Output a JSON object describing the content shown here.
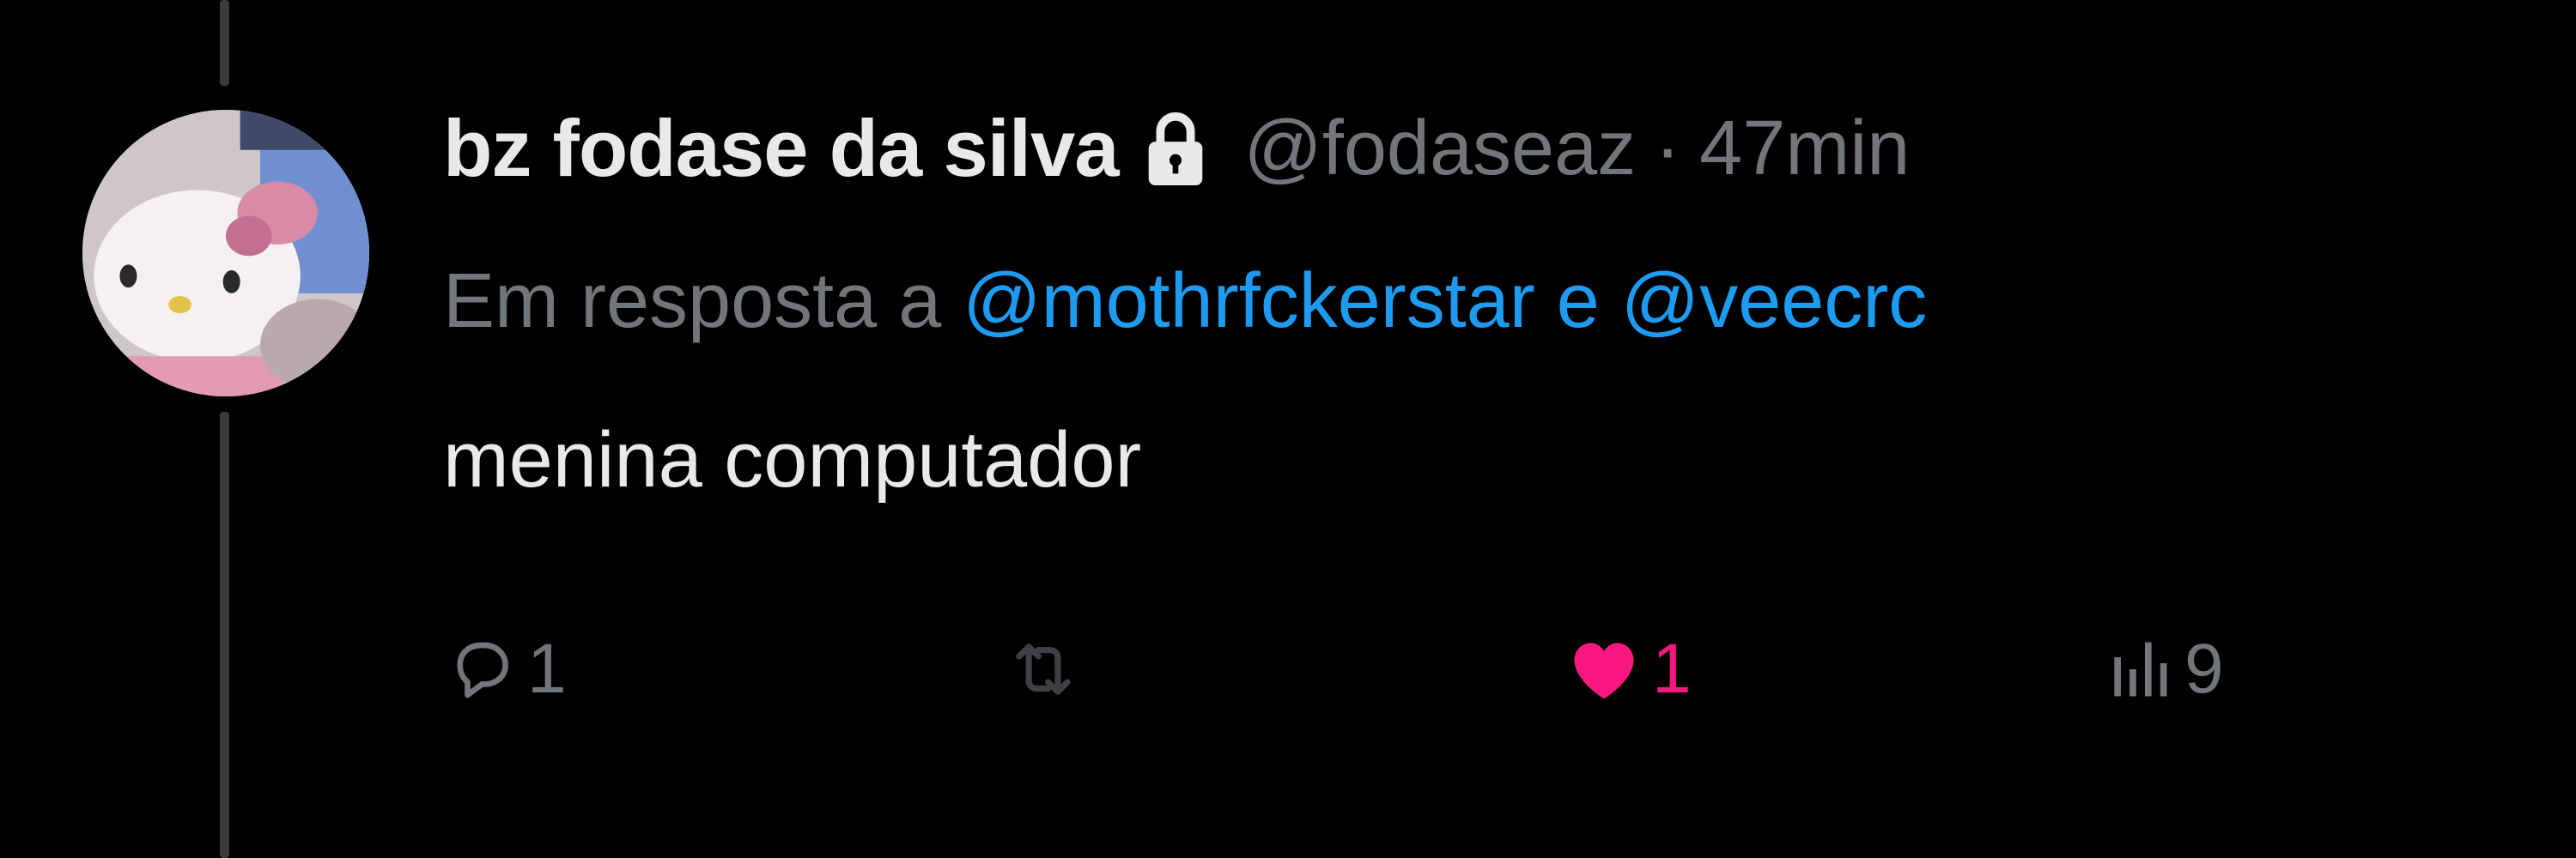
{
  "tweet": {
    "display_name": "bz fodase da silva",
    "protected_icon": "lock-icon",
    "handle": "@fodaseaz",
    "separator": "·",
    "time": "47min",
    "reply_prefix": "Em resposta a",
    "mention_1": "@mothrfckerstar",
    "mention_joiner": "e",
    "mention_2": "@veecrc",
    "text": "menina computador"
  },
  "actions": {
    "reply": {
      "icon": "reply-bubble-icon",
      "count": "1"
    },
    "retweet": {
      "icon": "retweet-icon",
      "count": ""
    },
    "like": {
      "icon": "heart-icon",
      "count": "1",
      "liked": true
    },
    "views": {
      "icon": "views-bar-chart-icon",
      "count": "9"
    }
  },
  "colors": {
    "background": "#000000",
    "primary_text": "#e7e9ea",
    "secondary_text": "#71767b",
    "mention": "#1d9bf0",
    "like": "#f91880",
    "disabled_icon": "#3e4144",
    "thread_line": "#3a3b3d"
  }
}
